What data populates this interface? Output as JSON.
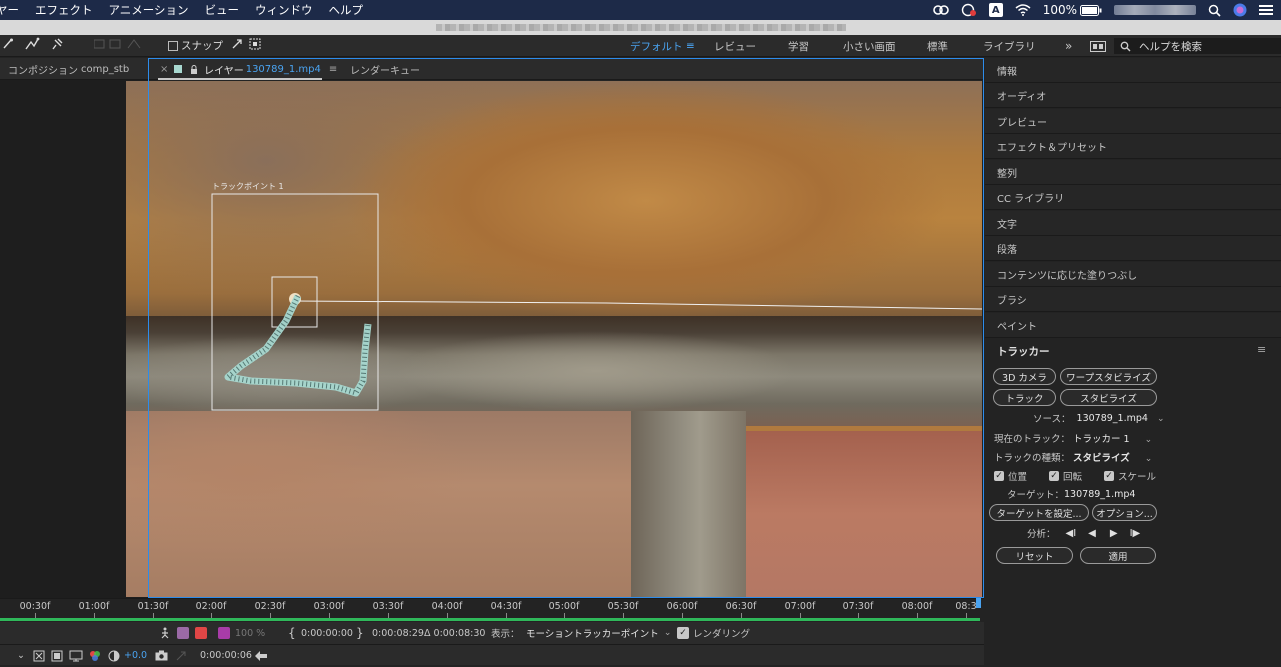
{
  "menubar": {
    "items": [
      "ヤー",
      "エフェクト",
      "アニメーション",
      "ビュー",
      "ウィンドウ",
      "ヘルプ"
    ],
    "battery": "100%",
    "icons": [
      "creative-cloud-icon",
      "screen-record-icon",
      "input-source-icon",
      "wifi-icon",
      "battery-icon",
      "search-icon",
      "siri-icon",
      "control-center-icon"
    ],
    "input_source": "A"
  },
  "toolbar": {
    "snap_label": "スナップ",
    "workspaces": [
      "デフォルト",
      "≡",
      "レビュー",
      "学習",
      "小さい画面",
      "標準",
      "ライブラリ",
      "»"
    ],
    "search_placeholder": "ヘルプを検索"
  },
  "tabs": {
    "comp_prefix": "コンポジション",
    "comp_name": "comp_stb",
    "close": "×",
    "layer_prefix": "レイヤー",
    "layer_file": "130789_1.mp4",
    "layer_menu": "≡",
    "render_queue": "レンダーキュー"
  },
  "viewer": {
    "track_point_label": "トラックポイント 1"
  },
  "right_panel": {
    "items": [
      "情報",
      "オーディオ",
      "プレビュー",
      "エフェクト＆プリセット",
      "整列",
      "CC ライブラリ",
      "文字",
      "段落",
      "コンテンツに応じた塗りつぶし",
      "ブラシ",
      "ペイント"
    ],
    "tracker": {
      "title": "トラッカー",
      "menu": "≡",
      "btn_3d_camera": "3D カメラ",
      "btn_warp_stabilizer": "ワープスタビライズ",
      "btn_track": "トラック",
      "btn_stabilize": "スタビライズ",
      "source_label": "ソース：",
      "source_value": "130789_1.mp4",
      "current_track_label": "現在のトラック：",
      "current_track_value": "トラッカー 1",
      "track_type_label": "トラックの種類：",
      "track_type_value": "スタビライズ",
      "cb_position": "位置",
      "cb_rotation": "回転",
      "cb_scale": "スケール",
      "target_label": "ターゲット：",
      "target_value": "130789_1.mp4",
      "btn_set_target": "ターゲットを設定...",
      "btn_options": "オプション...",
      "analyze_label": "分析：",
      "analyze_buttons": [
        "◀I",
        "◀",
        "▶",
        "I▶"
      ],
      "btn_reset": "リセット",
      "btn_apply": "適用"
    }
  },
  "timeline": {
    "ticks": [
      "00:30f",
      "01:00f",
      "01:30f",
      "02:00f",
      "02:30f",
      "03:00f",
      "03:30f",
      "04:00f",
      "04:30f",
      "05:00f",
      "05:30f",
      "06:00f",
      "06:30f",
      "07:00f",
      "07:30f",
      "08:00f",
      "08:3"
    ],
    "opacity": "100 %",
    "in_point": "0:00:00:00",
    "out_point": "0:00:08:29",
    "duration": "Δ 0:00:08:30",
    "view_label": "表示：",
    "view_value": "モーショントラッカーポイント",
    "render_label": "レンダリング",
    "exposure": "+0.0",
    "current_time": "0:00:00:06"
  },
  "colors": {
    "accent_blue": "#2d8ceb",
    "work_area_green": "#2fb85a",
    "track_point_fill": "#a8d8d0"
  }
}
